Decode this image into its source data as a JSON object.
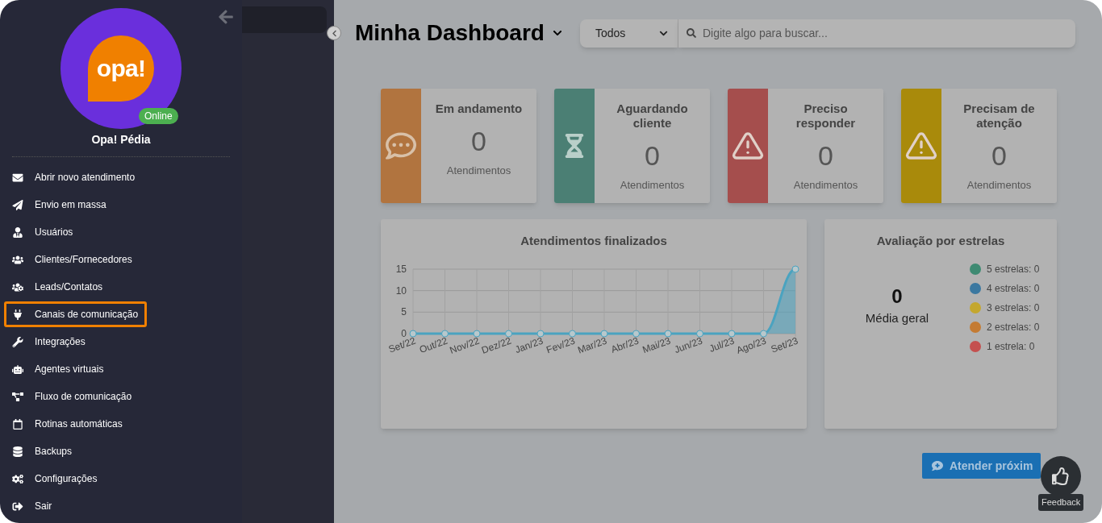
{
  "sidebar": {
    "profile": {
      "name": "Opa! Pédia",
      "logo_text": "opa!",
      "status": "Online"
    },
    "items": [
      {
        "label": "Abrir novo atendimento",
        "selected": false
      },
      {
        "label": "Envio em massa",
        "selected": false
      },
      {
        "label": "Usuários",
        "selected": false
      },
      {
        "label": "Clientes/Fornecedores",
        "selected": false
      },
      {
        "label": "Leads/Contatos",
        "selected": false
      },
      {
        "label": "Canais de comunicação",
        "selected": true
      },
      {
        "label": "Integrações",
        "selected": false
      },
      {
        "label": "Agentes virtuais",
        "selected": false
      },
      {
        "label": "Fluxo de comunicação",
        "selected": false
      },
      {
        "label": "Rotinas automáticas",
        "selected": false
      },
      {
        "label": "Backups",
        "selected": false
      },
      {
        "label": "Configurações",
        "selected": false
      },
      {
        "label": "Sair",
        "selected": false
      }
    ]
  },
  "header": {
    "title": "Minha Dashboard",
    "filter": "Todos",
    "search": {
      "placeholder": "Digite algo para buscar..."
    }
  },
  "cards": [
    {
      "kind": "chat",
      "title": "Em andamento",
      "value": "0",
      "unit": "Atendimentos",
      "color": "#b1743f"
    },
    {
      "kind": "hourglass",
      "title": "Aguardando cliente",
      "value": "0",
      "unit": "Atendimentos",
      "color": "#4b7f74"
    },
    {
      "kind": "warning",
      "title": "Preciso responder",
      "value": "0",
      "unit": "Atendimentos",
      "color": "#a54e4d"
    },
    {
      "kind": "warning",
      "title": "Precisam de atenção",
      "value": "0",
      "unit": "Atendimentos",
      "color": "#a98a0b"
    }
  ],
  "finished_chart": {
    "chart_data": {
      "type": "area",
      "title": "Atendimentos finalizados",
      "categories": [
        "Set/22",
        "Out/22",
        "Nov/22",
        "Dez/22",
        "Jan/23",
        "Fev/23",
        "Mar/23",
        "Abr/23",
        "Mai/23",
        "Jun/23",
        "Jul/23",
        "Ago/23",
        "Set/23"
      ],
      "series": [
        {
          "color": "#4aa3c0",
          "values": [
            0,
            0,
            0,
            0,
            0,
            0,
            0,
            0,
            0,
            0,
            0,
            0,
            15
          ]
        }
      ],
      "ylim": [
        0,
        15
      ],
      "yticks": [
        0,
        5,
        10,
        15
      ]
    }
  },
  "ratings": {
    "title": "Avaliação por estrelas",
    "average": "0",
    "average_label": "Média geral",
    "legend": [
      {
        "label": "5 estrelas: 0",
        "color": "#3e8a72"
      },
      {
        "label": "4 estrelas: 0",
        "color": "#3b78a0"
      },
      {
        "label": "3 estrelas: 0",
        "color": "#c4a72f"
      },
      {
        "label": "2 estrelas: 0",
        "color": "#c47b33"
      },
      {
        "label": "1 estrela: 0",
        "color": "#c4504f"
      }
    ]
  },
  "next_button": "Atender próxim",
  "feedback": "Feedback"
}
